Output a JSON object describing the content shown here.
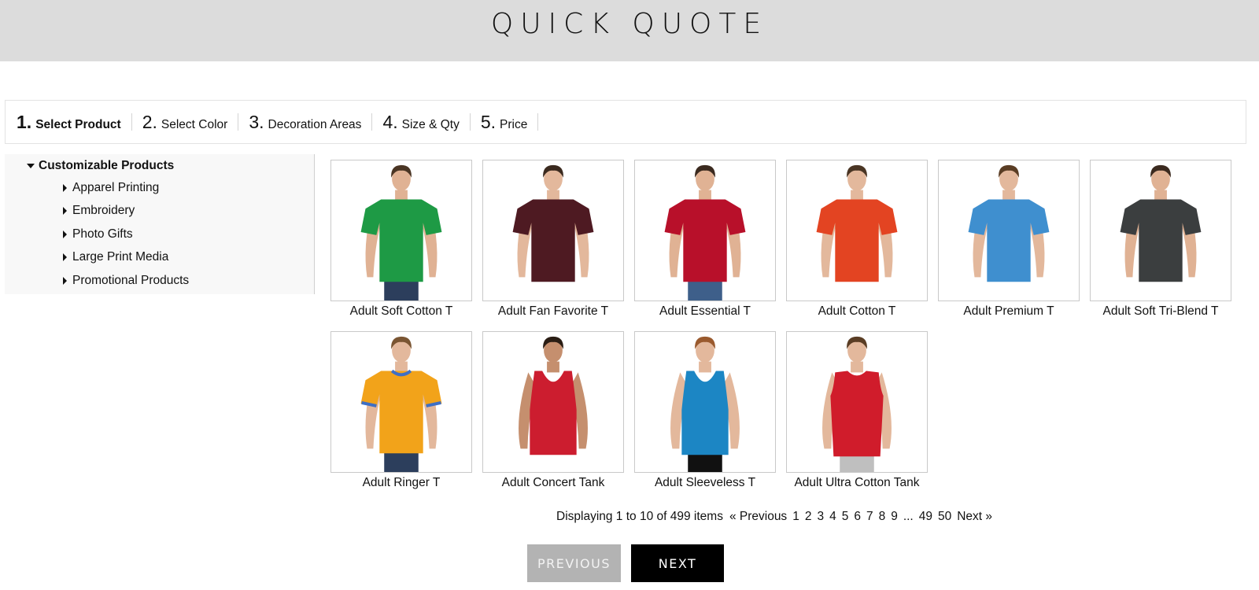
{
  "header": {
    "title": "QUICK QUOTE"
  },
  "steps": [
    {
      "num": "1.",
      "label": "Select Product",
      "active": true
    },
    {
      "num": "2.",
      "label": "Select Color"
    },
    {
      "num": "3.",
      "label": "Decoration Areas"
    },
    {
      "num": "4.",
      "label": "Size & Qty"
    },
    {
      "num": "5.",
      "label": "Price"
    }
  ],
  "sidebar": {
    "root": "Customizable Products",
    "children": [
      "Apparel Printing",
      "Embroidery",
      "Photo Gifts",
      "Large Print Media",
      "Promotional Products"
    ]
  },
  "products": [
    {
      "name": "Adult Soft Cotton T",
      "shirt": "#1e9a45",
      "skin": "#e0b294",
      "hair": "#4a3524",
      "pants": "#2c3e5c",
      "style": "tee"
    },
    {
      "name": "Adult Fan Favorite T",
      "shirt": "#4e1a22",
      "skin": "#e3b89c",
      "hair": "#3b2a1f",
      "pants": "#ffffff",
      "style": "tee"
    },
    {
      "name": "Adult Essential T",
      "shirt": "#b8102a",
      "skin": "#e0b294",
      "hair": "#3b2a1f",
      "pants": "#3e5f8a",
      "style": "tee"
    },
    {
      "name": "Adult Cotton T",
      "shirt": "#e34422",
      "skin": "#e3b89c",
      "hair": "#4a3524",
      "pants": "#ffffff",
      "style": "tee"
    },
    {
      "name": "Adult Premium T",
      "shirt": "#3f8fcf",
      "skin": "#e3b89c",
      "hair": "#5a3d24",
      "pants": "#ffffff",
      "style": "tee"
    },
    {
      "name": "Adult Soft Tri-Blend T",
      "shirt": "#3b3e3f",
      "skin": "#e0b294",
      "hair": "#3b2a1f",
      "pants": "#ffffff",
      "style": "tee"
    },
    {
      "name": "Adult Ringer T",
      "shirt": "#f2a31a",
      "skin": "#e3b89c",
      "hair": "#7a5532",
      "pants": "#2c3e5c",
      "style": "ringer",
      "trim": "#3f6fc4"
    },
    {
      "name": "Adult Concert Tank",
      "shirt": "#cc1d2f",
      "skin": "#c58f6e",
      "hair": "#2a1d14",
      "pants": "#ffffff",
      "style": "tank"
    },
    {
      "name": "Adult Sleeveless T",
      "shirt": "#1c86c4",
      "skin": "#e3b89c",
      "hair": "#9a5a2e",
      "pants": "#111111",
      "style": "tank"
    },
    {
      "name": "Adult Ultra Cotton Tank",
      "shirt": "#d01c2b",
      "skin": "#e3b89c",
      "hair": "#5a3d24",
      "pants": "#bfbfbf",
      "style": "sleeveless"
    }
  ],
  "pagination": {
    "summary": "Displaying 1 to 10 of 499 items",
    "previous": "« Previous",
    "pages": [
      "1",
      "2",
      "3",
      "4",
      "5",
      "6",
      "7",
      "8",
      "9",
      "...",
      "49",
      "50"
    ],
    "next": "Next »"
  },
  "buttons": {
    "previous": "PREVIOUS",
    "next": "NEXT"
  }
}
